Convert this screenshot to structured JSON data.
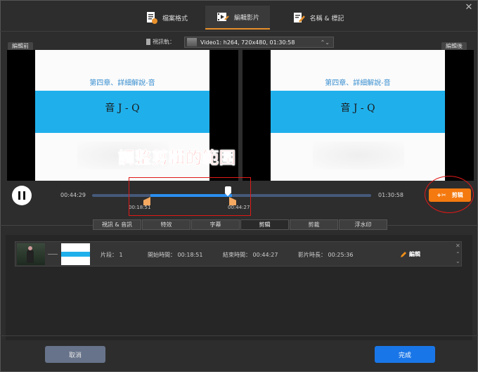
{
  "window": {
    "close_glyph": "✕"
  },
  "tabs": [
    {
      "label": "檔案格式",
      "icon": "file-format-icon",
      "active": false
    },
    {
      "label": "編輯影片",
      "icon": "edit-video-icon",
      "active": true
    },
    {
      "label": "名稱 & 標記",
      "icon": "rename-tag-icon",
      "active": false
    }
  ],
  "track": {
    "label": "視訊軌：",
    "value": "Video1: h264, 720x480, 01:30:58"
  },
  "panes": {
    "before_label": "編輯前",
    "after_label": "編輯後",
    "slide_title": "第四章、詳細解說-音",
    "slide_main": "音 J - Q"
  },
  "annotation": {
    "caption": "調整剪輯的範圍"
  },
  "timeline": {
    "current_time": "00:44:29",
    "total_time": "01:30:58",
    "start_handle": "00:18:51",
    "end_handle": "00:44:27",
    "cut_label": "剪辑",
    "cut_icon": "+✂"
  },
  "subtabs": [
    {
      "label": "視訊 & 音訊",
      "active": false
    },
    {
      "label": "特效",
      "active": false
    },
    {
      "label": "字幕",
      "active": false
    },
    {
      "label": "剪辑",
      "active": true
    },
    {
      "label": "剪裁",
      "active": false
    },
    {
      "label": "浮水印",
      "active": false
    }
  ],
  "clip": {
    "segment": "片段： 1",
    "start": "開始時間： 00:18:51",
    "end": "結束時間： 00:44:27",
    "duration": "影片時長： 00:25:36",
    "edit_label": "編輯"
  },
  "buttons": {
    "cancel": "取消",
    "done": "完成"
  },
  "colors": {
    "accent": "#f47a10",
    "primary": "#1976e8",
    "selection": "#2a8ff0",
    "annotation": "#e01818"
  }
}
